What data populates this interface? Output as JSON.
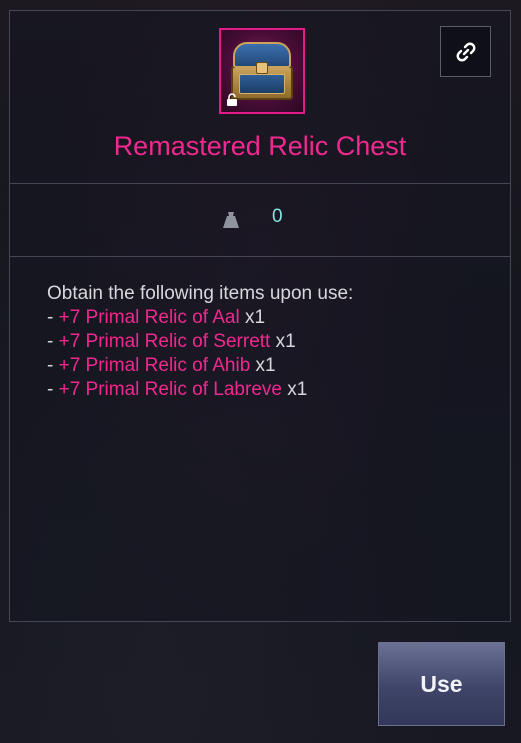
{
  "item": {
    "name": "Remastered Relic Chest",
    "icon": "treasure-chest-icon",
    "locked_badge": "padlock-icon"
  },
  "stats": {
    "weight_icon": "weight-icon",
    "weight_value": "0"
  },
  "description": {
    "intro": "Obtain the following items upon use:",
    "items": [
      {
        "prefix": "- ",
        "name": "+7 Primal Relic of Aal",
        "qty": " x1"
      },
      {
        "prefix": "- ",
        "name": "+7 Primal Relic of Serrett",
        "qty": " x1"
      },
      {
        "prefix": "- ",
        "name": "+7 Primal Relic of Ahib",
        "qty": " x1"
      },
      {
        "prefix": "- ",
        "name": "+7 Primal Relic of Labreve",
        "qty": " x1"
      }
    ]
  },
  "actions": {
    "link_icon": "link-icon",
    "use_label": "Use"
  },
  "colors": {
    "accent_pink": "#f0288f",
    "weight_value": "#7ee6df",
    "border": "#454756"
  }
}
